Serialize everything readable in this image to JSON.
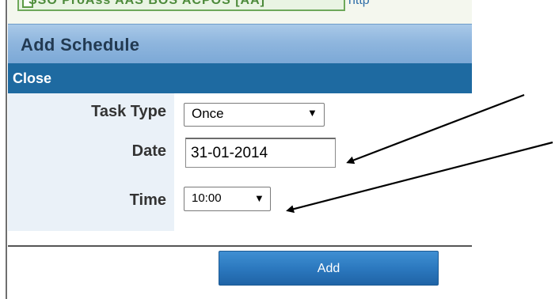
{
  "top_strip": {
    "cut_text": "SSO ProAss AAS BOS ACPOS [AA]",
    "cut_link": "http"
  },
  "dialog": {
    "title": "Add Schedule",
    "close_label": "Close",
    "fields": {
      "task_type": {
        "label": "Task Type",
        "value": "Once"
      },
      "date": {
        "label": "Date",
        "value": "31-01-2014"
      },
      "time": {
        "label": "Time",
        "value": "10:00"
      }
    },
    "add_label": "Add"
  },
  "icons": {
    "dropdown_arrow": "▼"
  },
  "colors": {
    "title_bar": "#8fb6de",
    "close_bar": "#1e6aa1",
    "label_column": "#eaf1f8",
    "add_button": "#2c79bf"
  }
}
